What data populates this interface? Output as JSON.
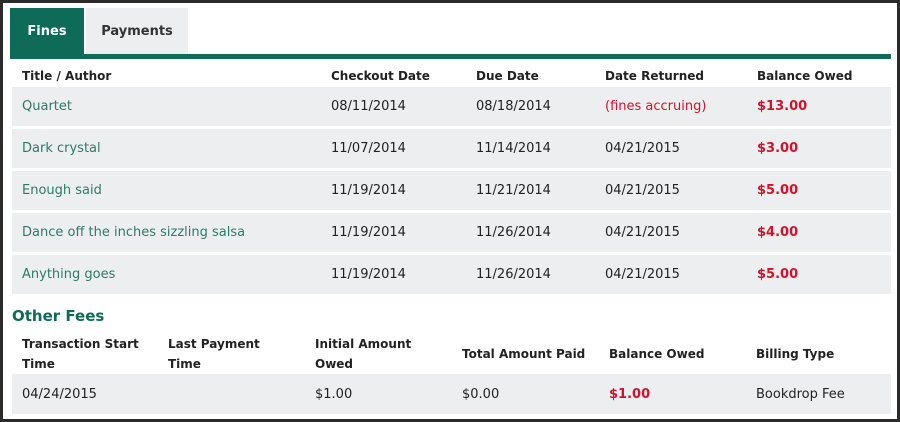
{
  "tabs": [
    {
      "label": "Fines",
      "active": true
    },
    {
      "label": "Payments",
      "active": false
    }
  ],
  "fines": {
    "headers": [
      "Title / Author",
      "Checkout Date",
      "Due Date",
      "Date Returned",
      "Balance Owed"
    ],
    "rows": [
      {
        "title": "Quartet",
        "checkout": "08/11/2014",
        "due": "08/18/2014",
        "returned": "(fines accruing)",
        "balance": "$13.00"
      },
      {
        "title": "Dark crystal",
        "checkout": "11/07/2014",
        "due": "11/14/2014",
        "returned": "04/21/2015",
        "balance": "$3.00"
      },
      {
        "title": "Enough said",
        "checkout": "11/19/2014",
        "due": "11/21/2014",
        "returned": "04/21/2015",
        "balance": "$5.00"
      },
      {
        "title": "Dance off the inches sizzling salsa",
        "checkout": "11/19/2014",
        "due": "11/26/2014",
        "returned": "04/21/2015",
        "balance": "$4.00"
      },
      {
        "title": "Anything goes",
        "checkout": "11/19/2014",
        "due": "11/26/2014",
        "returned": "04/21/2015",
        "balance": "$5.00"
      }
    ]
  },
  "other_fees": {
    "title": "Other Fees",
    "headers": [
      "Transaction Start Time",
      "Last Payment Time",
      "Initial Amount Owed",
      "Total Amount Paid",
      "Balance Owed",
      "Billing Type"
    ],
    "rows": [
      {
        "start": "04/24/2015",
        "last_payment": "",
        "initial": "$1.00",
        "paid": "$0.00",
        "balance": "$1.00",
        "billing_type": "Bookdrop Fee"
      }
    ]
  },
  "colors": {
    "brand_green": "#0e6b57",
    "link_green": "#2e7a68",
    "balance_red": "#d0122c",
    "row_bg": "#eceef0"
  }
}
